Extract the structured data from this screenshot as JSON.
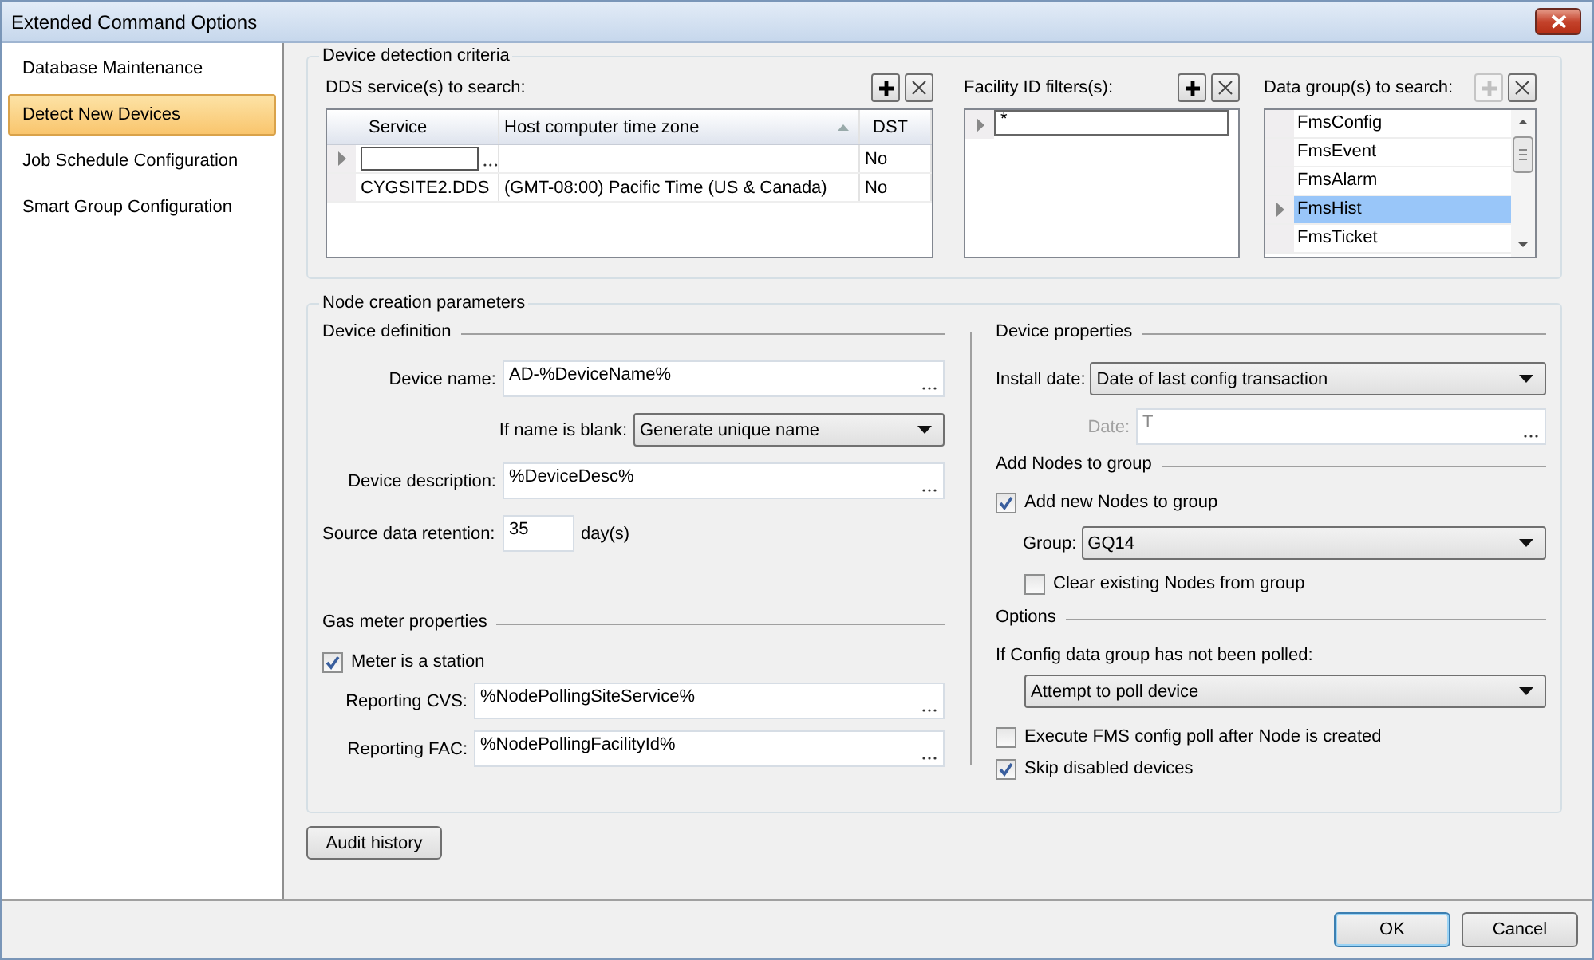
{
  "window": {
    "title": "Extended Command Options"
  },
  "sidebar": {
    "items": [
      {
        "label": "Database Maintenance",
        "selected": false
      },
      {
        "label": "Detect New Devices",
        "selected": true
      },
      {
        "label": "Job Schedule Configuration",
        "selected": false
      },
      {
        "label": "Smart Group Configuration",
        "selected": false
      }
    ]
  },
  "detection": {
    "title": "Device detection criteria",
    "dds": {
      "label": "DDS service(s) to search:",
      "add_disabled": false,
      "columns": [
        {
          "label": "Service",
          "sorted": false
        },
        {
          "label": "Host computer time zone",
          "sorted": true
        },
        {
          "label": "DST",
          "sorted": false
        }
      ],
      "rows": [
        {
          "current": true,
          "editing": true,
          "service": "",
          "timezone": "",
          "dst": "No"
        },
        {
          "current": false,
          "editing": false,
          "service": "CYGSITE2.DDS",
          "timezone": "(GMT-08:00) Pacific Time (US & Canada)",
          "dst": "No"
        }
      ]
    },
    "facility": {
      "label": "Facility ID filters(s):",
      "add_disabled": false,
      "rows": [
        {
          "current": true,
          "value": "*"
        }
      ]
    },
    "data_groups": {
      "label": "Data group(s) to search:",
      "add_disabled": true,
      "items": [
        {
          "label": "FmsConfig",
          "selected": false
        },
        {
          "label": "FmsEvent",
          "selected": false
        },
        {
          "label": "FmsAlarm",
          "selected": false
        },
        {
          "label": "FmsHist",
          "selected": true
        },
        {
          "label": "FmsTicket",
          "selected": false
        }
      ]
    }
  },
  "node": {
    "title": "Node creation parameters",
    "device_definition": {
      "title": "Device definition",
      "device_name": {
        "label": "Device name:",
        "value": "AD-%DeviceName%"
      },
      "if_blank": {
        "label": "If name is blank:",
        "value": "Generate unique name"
      },
      "description": {
        "label": "Device description:",
        "value": "%DeviceDesc%"
      },
      "retention": {
        "label": "Source data retention:",
        "value": "35",
        "unit": "day(s)"
      }
    },
    "gas_meter": {
      "title": "Gas meter properties",
      "is_station": {
        "label": "Meter is a station",
        "checked": true
      },
      "cvs": {
        "label": "Reporting CVS:",
        "value": "%NodePollingSiteService%"
      },
      "fac": {
        "label": "Reporting FAC:",
        "value": "%NodePollingFacilityId%"
      }
    },
    "device_properties": {
      "title": "Device properties",
      "install_date": {
        "label": "Install date:",
        "value": "Date of last config transaction"
      },
      "date": {
        "label": "Date:",
        "value": "T",
        "disabled": true
      }
    },
    "add_nodes": {
      "title": "Add Nodes to group",
      "add_new": {
        "label": "Add new Nodes to group",
        "checked": true
      },
      "group": {
        "label": "Group:",
        "value": "GQ14"
      },
      "clear_existing": {
        "label": "Clear existing Nodes from group",
        "checked": false
      }
    },
    "options": {
      "title": "Options",
      "not_polled_label": "If Config data group has not been polled:",
      "not_polled": "Attempt to poll device",
      "checks": [
        {
          "label": "Execute FMS config poll after Node is created",
          "checked": false
        },
        {
          "label": "Skip disabled devices",
          "checked": true
        }
      ]
    }
  },
  "audit_button": "Audit history",
  "buttons": [
    {
      "label": "OK",
      "default": true
    },
    {
      "label": "Cancel",
      "default": false
    }
  ]
}
